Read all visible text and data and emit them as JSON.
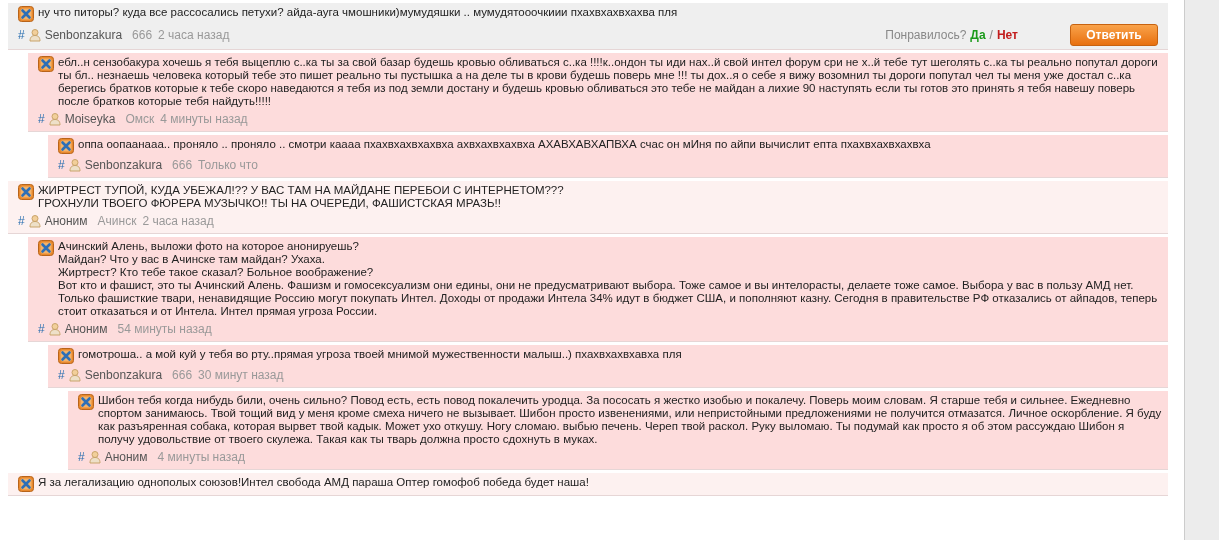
{
  "comments": [
    {
      "color": "#efefef",
      "text": "ну что питоры? куда все рассосались петухи? айда-ауга чмошники)мумудяшки .. мумудятооочкиии пхахвхахвхахва пля",
      "permalink": "#",
      "author": "Senbonzakura",
      "location": "666",
      "time": "2 часа назад",
      "rating": {
        "question": "Понравилось?",
        "yes": "Да",
        "separator": "/",
        "no": "Нет"
      },
      "reply_button": "Ответить",
      "children": [
        {
          "color": "#fddcdc",
          "text": "ебл..н сензобакура хочешь я тебя выцеплю с..ка ты за свой базар будешь кровью обливаться с..ка !!!!к..ондон ты иди нах..й свой интел форум сри не х..й тебе тут шеголять с..ка ты реально попутал дороги ты бл.. незнаешь человека который тебе это пишет реально ты пустышка а на деле ты в крови будешь поверь мне !!! ты дох..я о себе я вижу возомнил ты дороги попутал чел ты меня уже достал с..ка берегись братков которые к тебе скоро наведаются я тебя из под земли достану и будешь кровью обливаться это тебе не майдан а лихие 90 наступять если ты готов это принять я тебя навешу поверь после братков которые тебя найдуть!!!!!",
          "permalink": "#",
          "author": "Moiseyka",
          "location": "Омск",
          "time": "4 минуты назад",
          "children": [
            {
              "color": "#fddcdc",
              "text": "оппа оопаанааа.. проняло .. проняло .. смотри каааа пхахвхахвхахвха ахвхахвхахвха АХАВХАВХАПВХА счас он мИня по айпи вычислит епта пхахвхахвхахвха",
              "permalink": "#",
              "author": "Senbonzakura",
              "location": "666",
              "time": "Только что"
            }
          ]
        }
      ]
    },
    {
      "color": "#fdf1f0",
      "text": "ЖИРТРЕСТ ТУПОЙ, КУДА УБЕЖАЛ!?? У ВАС ТАМ НА МАЙДАНЕ ПЕРЕБОИ С ИНТЕРНЕТОМ???\nГРОХНУЛИ ТВОЕГО ФЮРЕРА МУЗЫЧКО!! ТЫ НА ОЧЕРЕДИ, ФАШИСТСКАЯ МРАЗЬ!!",
      "permalink": "#",
      "author": "Аноним",
      "location": "Ачинск",
      "time": "2 часа назад",
      "children": [
        {
          "color": "#fddcdc",
          "text": "Ачинский Алень, выложи фото на которое анонируешь?\nМайдан? Что у вас в Ачинске там майдан? Ухаха.\nЖиртрест? Кто тебе такое сказал? Больное воображение?\nВот кто и фашист, это ты Ачинский Алень. Фашизм и гомосексуализм они едины, они не предусматривают выбора. Тоже самое и вы интелорасты, делаете тоже самое. Выбора у вас в пользу АМД нет. Только фашисткие твари, ненавидящие Россию могут покупать Интел. Доходы от продажи Интела 34% идут в бюджет США, и пополняют казну. Сегодня в правительстве РФ отказались от айпадов, теперь стоит отказаться и от Интела. Интел прямая угроза России.",
          "permalink": "#",
          "author": "Аноним",
          "time": "54 минуты назад",
          "children": [
            {
              "color": "#fddcdc",
              "text": "гомотроша.. а мой куй у тебя во рту..прямая угроза твоей мнимой мужественности малыш..) пхахвхахвхавха пля",
              "permalink": "#",
              "author": "Senbonzakura",
              "location": "666",
              "time": "30 минут назад",
              "children": [
                {
                  "color": "#fddcdc",
                  "text": "Шибон тебя когда нибудь били, очень сильно? Повод есть, есть повод покалечить уродца. За пососать я жестко изобью и покалечу. Поверь моим словам. Я старше тебя и сильнее. Ежедневно спортом занимаюсь. Твой тощий вид у меня кроме смеха ничего не вызывает. Шибон просто извенениями, или непристойными предложениями не получится отмазатся. Личное оскорбление. Я буду как разъяренная собака, которая вырвет твой кадык. Может ухо откушу. Ногу сломаю. выбью печень. Череп твой раскол. Руку выломаю. Ты подумай как просто я об этом рассуждаю Шибон я получу удовольствие от твоего скулежа. Такая как ты тварь должна просто сдохнуть в муках.",
                  "permalink": "#",
                  "author": "Аноним",
                  "time": "4 минуты назад"
                }
              ]
            }
          ]
        }
      ]
    },
    {
      "color": "#fdf1f0",
      "text": "Я за легализацию однополых союзов!Интел свобода АМД параша Оптер гомофоб победа будет наша!"
    }
  ]
}
